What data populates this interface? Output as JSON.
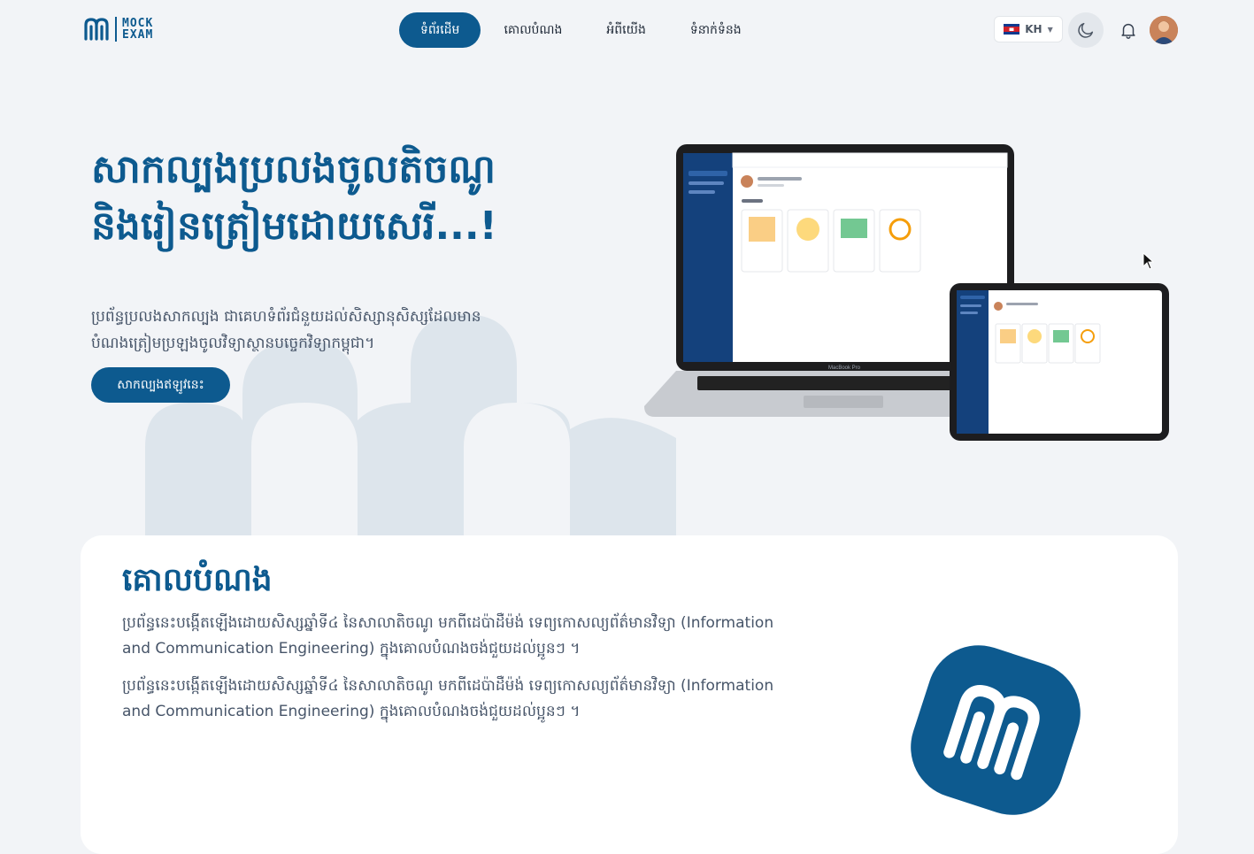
{
  "header": {
    "logo": {
      "line1": "MOCK",
      "line2": "EXAM"
    },
    "nav": [
      {
        "label": "ទំព័រដើម",
        "active": true
      },
      {
        "label": "គោលបំណង",
        "active": false
      },
      {
        "label": "អំពីយើង",
        "active": false
      },
      {
        "label": "ទំនាក់ទំនង",
        "active": false
      }
    ],
    "language": {
      "code": "KH",
      "flag": "cambodia-flag-icon"
    },
    "icons": [
      "moon-icon",
      "bell-icon",
      "avatar"
    ]
  },
  "hero": {
    "title": "សាកល្បងប្រលងចូលតិចណូនិងរៀនត្រៀមដោយសេរី...!",
    "description": "ប្រព័ន្ធប្រលងសាកល្បង ជាគេហទំព័រជំនួយដល់សិស្សានុសិស្សដែលមានបំណងត្រៀមប្រឡងចូលវិទ្យាស្ថានបច្ចេកវិទ្យាកម្ពុជា។",
    "cta_label": "សាកល្បងឥឡូវនេះ",
    "laptop_label": "MacBook Pro"
  },
  "goal": {
    "title": "គោលបំណង",
    "paragraph1": "ប្រព័ន្ធនេះបង្កើតឡើងដោយសិស្សឆ្នាំទី៤ នៃសាលាតិចណូ មកពីដេប៉ាដឺម៉ង់ ទេព្យកោសល្យព័ត៌មានវិទ្យា (Information and Communication Engineering) ក្នុងគោលបំណងចង់ជួយដល់ប្អូនៗ ។",
    "paragraph2": "ប្រព័ន្ធនេះបង្កើតឡើងដោយសិស្សឆ្នាំទី៤ នៃសាលាតិចណូ មកពីដេប៉ាដឺម៉ង់ ទេព្យកោសល្យព័ត៌មានវិទ្យា (Information and Communication Engineering) ក្នុងគោលបំណងចង់ជួយដល់ប្អូនៗ ។"
  },
  "colors": {
    "brand": "#0d5a8f",
    "background": "#f2f4f7",
    "card": "#ffffff",
    "hero_shape": "#dde5ec"
  }
}
